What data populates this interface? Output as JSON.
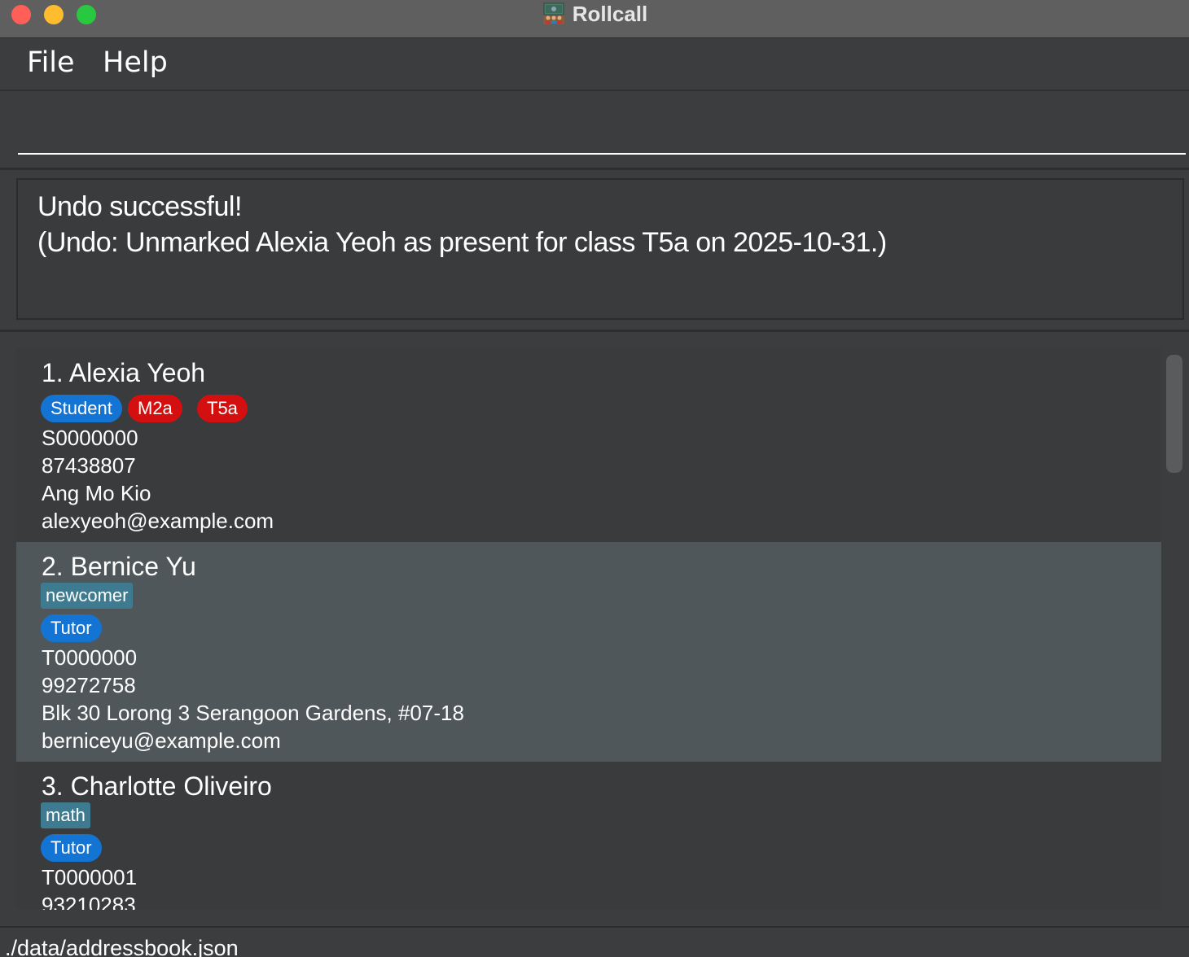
{
  "window": {
    "title": "Rollcall",
    "app_icon": "classroom-icon"
  },
  "menu": {
    "file": "File",
    "help": "Help"
  },
  "command_box": {
    "value": "",
    "placeholder": ""
  },
  "result": {
    "line1": "Undo successful!",
    "line2": "(Undo: Unmarked Alexia Yeoh as present for class T5a on 2025-10-31.)"
  },
  "persons": [
    {
      "name": "1. Alexia Yeoh",
      "tags": [],
      "role": "Student",
      "classes": [
        "M2a",
        "T5a"
      ],
      "id": "S0000000",
      "phone": "87438807",
      "address": "Ang Mo Kio",
      "email": "alexyeoh@example.com"
    },
    {
      "name": "2. Bernice Yu",
      "tags": [
        "newcomer"
      ],
      "role": "Tutor",
      "classes": [],
      "id": "T0000000",
      "phone": "99272758",
      "address": "Blk 30 Lorong 3 Serangoon Gardens, #07-18",
      "email": "berniceyu@example.com"
    },
    {
      "name": "3. Charlotte Oliveiro",
      "tags": [
        "math"
      ],
      "role": "Tutor",
      "classes": [],
      "id": "T0000001",
      "phone": "93210283"
    }
  ],
  "status": {
    "file_path": "./data/addressbook.json"
  },
  "colors": {
    "role_pill": "#1474d4",
    "class_pill": "#d40f0f",
    "tag": "#3e7b91",
    "selected_card": "#50575a"
  }
}
